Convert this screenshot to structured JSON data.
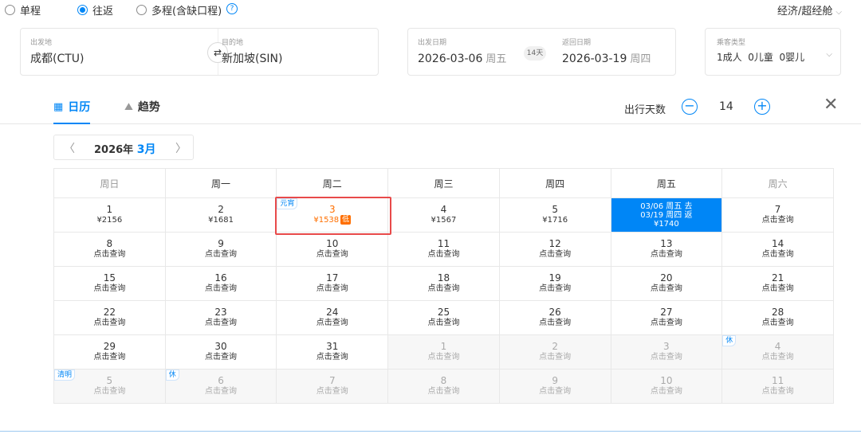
{
  "trip_types": [
    {
      "label": "单程",
      "checked": false
    },
    {
      "label": "往返",
      "checked": true
    },
    {
      "label": "多程(含缺口程)",
      "checked": false
    }
  ],
  "help_icon": "?",
  "cabin": "经济/超经舱",
  "origin": {
    "label": "出发地",
    "value": "成都(CTU)"
  },
  "destination": {
    "label": "目的地",
    "value": "新加坡(SIN)"
  },
  "swap_icon": "⇄",
  "depart": {
    "label": "出发日期",
    "date": "2026-03-06",
    "weekday": "周五"
  },
  "trip_days_badge": "14天",
  "return": {
    "label": "返回日期",
    "date": "2026-03-19",
    "weekday": "周四"
  },
  "passengers": {
    "label": "乘客类型",
    "value": "1成人  0儿童  0婴儿"
  },
  "tabs": [
    {
      "label": "日历",
      "icon": "calendar-icon",
      "active": true
    },
    {
      "label": "趋势",
      "icon": "trend-icon",
      "active": false
    }
  ],
  "trip_days": {
    "label": "出行天数",
    "value": "14"
  },
  "month_nav": {
    "year": "2026年",
    "month": "3月"
  },
  "weekdays": [
    "周日",
    "周一",
    "周二",
    "周三",
    "周四",
    "周五",
    "周六"
  ],
  "query_text": "点击查询",
  "accent_color": "#0086f6",
  "low_price_color": "#ff6f00",
  "weeks": [
    [
      {
        "day": "1",
        "price": "¥2156"
      },
      {
        "day": "2",
        "price": "¥1681"
      },
      {
        "day": "3",
        "price": "¥1538",
        "low": true,
        "badge": "低",
        "tag": "元宵"
      },
      {
        "day": "4",
        "price": "¥1567"
      },
      {
        "day": "5",
        "price": "¥1716"
      },
      {
        "selected": true,
        "line1": "03/06 周五 去",
        "line2": "03/19 周四 返",
        "price": "¥1740"
      },
      {
        "day": "7",
        "price": "点击查询"
      }
    ],
    [
      {
        "day": "8",
        "price": "点击查询"
      },
      {
        "day": "9",
        "price": "点击查询"
      },
      {
        "day": "10",
        "price": "点击查询"
      },
      {
        "day": "11",
        "price": "点击查询"
      },
      {
        "day": "12",
        "price": "点击查询"
      },
      {
        "day": "13",
        "price": "点击查询"
      },
      {
        "day": "14",
        "price": "点击查询"
      }
    ],
    [
      {
        "day": "15",
        "price": "点击查询"
      },
      {
        "day": "16",
        "price": "点击查询"
      },
      {
        "day": "17",
        "price": "点击查询"
      },
      {
        "day": "18",
        "price": "点击查询"
      },
      {
        "day": "19",
        "price": "点击查询"
      },
      {
        "day": "20",
        "price": "点击查询"
      },
      {
        "day": "21",
        "price": "点击查询"
      }
    ],
    [
      {
        "day": "22",
        "price": "点击查询"
      },
      {
        "day": "23",
        "price": "点击查询"
      },
      {
        "day": "24",
        "price": "点击查询"
      },
      {
        "day": "25",
        "price": "点击查询"
      },
      {
        "day": "26",
        "price": "点击查询"
      },
      {
        "day": "27",
        "price": "点击查询"
      },
      {
        "day": "28",
        "price": "点击查询"
      }
    ],
    [
      {
        "day": "29",
        "price": "点击查询"
      },
      {
        "day": "30",
        "price": "点击查询"
      },
      {
        "day": "31",
        "price": "点击查询"
      },
      {
        "day": "1",
        "price": "点击查询",
        "other": true
      },
      {
        "day": "2",
        "price": "点击查询",
        "other": true
      },
      {
        "day": "3",
        "price": "点击查询",
        "other": true
      },
      {
        "day": "4",
        "price": "点击查询",
        "other": true,
        "tag": "休"
      }
    ],
    [
      {
        "day": "5",
        "price": "点击查询",
        "other": true,
        "tag": "清明"
      },
      {
        "day": "6",
        "price": "点击查询",
        "other": true,
        "tag": "休"
      },
      {
        "day": "7",
        "price": "点击查询",
        "other": true
      },
      {
        "day": "8",
        "price": "点击查询",
        "other": true
      },
      {
        "day": "9",
        "price": "点击查询",
        "other": true
      },
      {
        "day": "10",
        "price": "点击查询",
        "other": true
      },
      {
        "day": "11",
        "price": "点击查询",
        "other": true
      }
    ]
  ]
}
